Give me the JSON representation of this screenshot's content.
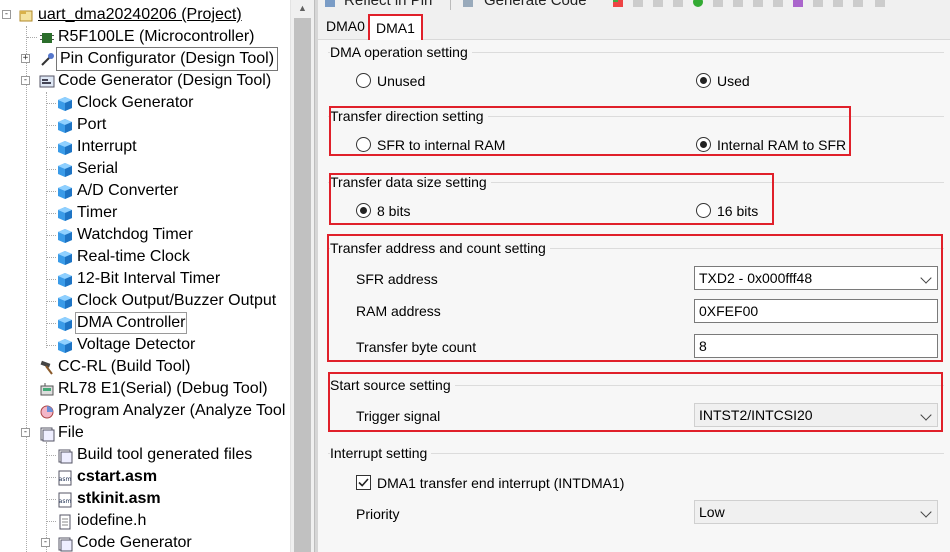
{
  "tree": {
    "items": [
      {
        "label": "uart_dma20240206 (Project)",
        "icon": "project-icon"
      },
      {
        "label": "R5F100LE (Microcontroller)",
        "icon": "microcontroller-chip-icon"
      },
      {
        "label": "Pin Configurator (Design Tool)",
        "icon": "pin-configurator-icon",
        "expander": "+"
      },
      {
        "label": "Code Generator (Design Tool)",
        "icon": "code-generator-icon",
        "expander": "-"
      },
      {
        "label": "Clock Generator",
        "icon": "cube-icon"
      },
      {
        "label": "Port",
        "icon": "cube-icon"
      },
      {
        "label": "Interrupt",
        "icon": "cube-icon"
      },
      {
        "label": "Serial",
        "icon": "cube-icon"
      },
      {
        "label": "A/D Converter",
        "icon": "cube-icon"
      },
      {
        "label": "Timer",
        "icon": "cube-icon"
      },
      {
        "label": "Watchdog Timer",
        "icon": "cube-icon"
      },
      {
        "label": "Real-time Clock",
        "icon": "cube-icon"
      },
      {
        "label": "12-Bit Interval Timer",
        "icon": "cube-icon"
      },
      {
        "label": "Clock Output/Buzzer Output",
        "icon": "cube-icon"
      },
      {
        "label": "DMA Controller",
        "icon": "cube-icon"
      },
      {
        "label": "Voltage Detector",
        "icon": "cube-icon"
      },
      {
        "label": "CC-RL (Build Tool)",
        "icon": "hammer-icon"
      },
      {
        "label": "RL78 E1(Serial) (Debug Tool)",
        "icon": "debugger-icon"
      },
      {
        "label": "Program Analyzer (Analyze Tool",
        "icon": "analyzer-icon"
      },
      {
        "label": "File",
        "icon": "folder-icon",
        "expander": "-"
      },
      {
        "label": "Build tool generated files",
        "icon": "folder-icon"
      },
      {
        "label": "cstart.asm",
        "icon": "asm-file-icon"
      },
      {
        "label": "stkinit.asm",
        "icon": "asm-file-icon"
      },
      {
        "label": "iodefine.h",
        "icon": "header-file-icon"
      },
      {
        "label": "Code Generator",
        "icon": "folder-icon",
        "expander": "-"
      }
    ],
    "tooltip": "Pin Configurator (Design Tool)"
  },
  "toolbar": {
    "reflect_label": "Reflect in Pin",
    "generate_label": "Generate Code"
  },
  "tabs": [
    "DMA0",
    "DMA1"
  ],
  "dma_operation": {
    "title": "DMA operation setting",
    "unused": "Unused",
    "used": "Used",
    "selected": "Used"
  },
  "transfer_direction": {
    "title": "Transfer direction setting",
    "opt1": "SFR to internal RAM",
    "opt2": "Internal RAM to SFR",
    "selected": "Internal RAM to SFR"
  },
  "transfer_size": {
    "title": "Transfer data size setting",
    "opt1": "8 bits",
    "opt2": "16 bits",
    "selected": "8 bits"
  },
  "address_count": {
    "title": "Transfer address and count setting",
    "sfr_label": "SFR address",
    "sfr_value": "TXD2 - 0x000fff48",
    "ram_label": "RAM address",
    "ram_value": "0XFEF00",
    "count_label": "Transfer byte count",
    "count_value": "8"
  },
  "start_source": {
    "title": "Start source setting",
    "trigger_label": "Trigger signal",
    "trigger_value": "INTST2/INTCSI20"
  },
  "interrupt": {
    "title": "Interrupt setting",
    "checkbox_label": "DMA1 transfer end interrupt (INTDMA1)",
    "checked": true,
    "priority_label": "Priority",
    "priority_value": "Low"
  },
  "colors": {
    "highlight": "#e0202a",
    "cube": "#2d8fe0"
  }
}
